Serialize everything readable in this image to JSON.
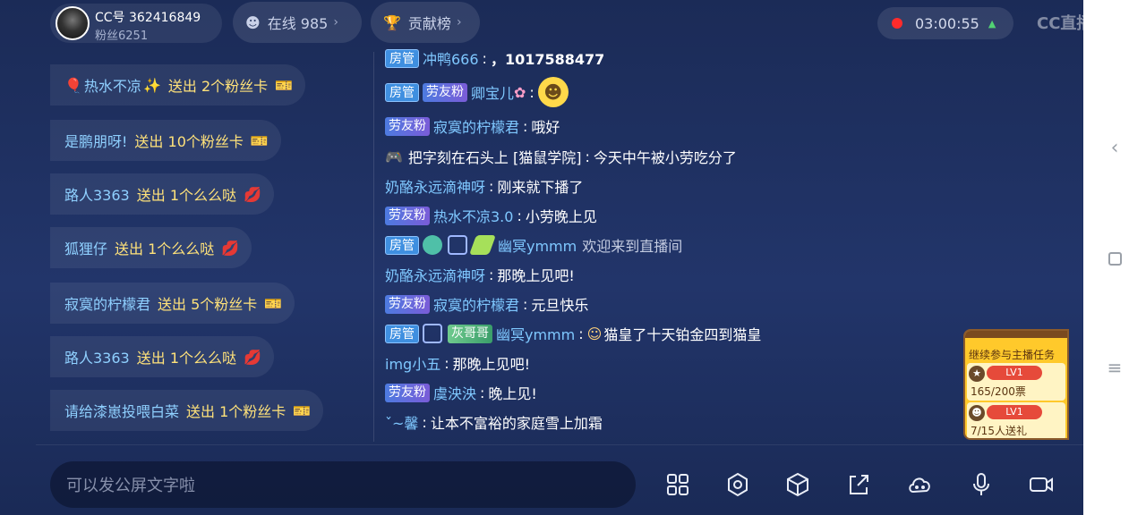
{
  "header": {
    "cc_id": "CC号 362416849",
    "fans": "粉丝6251",
    "online": "在线 985",
    "rank": "贡献榜",
    "timer": "03:00:55",
    "logo": "CC直播"
  },
  "gifts": [
    {
      "user": "热水不凉",
      "action": "送出 2个粉丝卡",
      "icon": "card"
    },
    {
      "user": "是鹏朋呀!",
      "action": "送出 10个粉丝卡",
      "icon": "card"
    },
    {
      "user": "路人3363",
      "action": "送出 1个么么哒",
      "icon": "kiss"
    },
    {
      "user": "狐狸仔",
      "action": "送出 1个么么哒",
      "icon": "kiss"
    },
    {
      "user": "寂寞的柠檬君",
      "action": "送出 5个粉丝卡",
      "icon": "card"
    },
    {
      "user": "路人3363",
      "action": "送出 1个么么哒",
      "icon": "kiss"
    },
    {
      "user": "请给漆崽投喂白菜",
      "action": "送出 1个粉丝卡",
      "icon": "card"
    }
  ],
  "badges": {
    "manager": "房管",
    "fan": "劳友粉",
    "grey": "灰哥哥"
  },
  "chat": [
    {
      "user": "冲鸭666",
      "text": "，1017588477"
    },
    {
      "user": "卿宝儿",
      "text": ""
    },
    {
      "user": "寂寞的柠檬君",
      "text": "哦好"
    },
    {
      "user": "把字刻在石头上 [猫鼠学院]",
      "text": "今天中午被小劳吃分了"
    },
    {
      "user": "奶酪永远滴神呀",
      "text": "刚来就下播了"
    },
    {
      "user": "热水不凉3.0",
      "text": "小劳晚上见"
    },
    {
      "user": "幽冥ymmm",
      "text": "欢迎来到直播间"
    },
    {
      "user": "奶酪永远滴神呀",
      "text": "那晚上见吧!"
    },
    {
      "user": "寂寞的柠檬君",
      "text": "元旦快乐"
    },
    {
      "user": "幽冥ymmm",
      "text": "猫皇了十天铂金四到猫皇"
    },
    {
      "user": "img小五",
      "text": "那晚上见吧!"
    },
    {
      "user": "虞泱泱",
      "text": "晚上见!"
    },
    {
      "user": "ˇ~馨",
      "text": "让本不富裕的家庭雪上加霜"
    }
  ],
  "task": {
    "title": "继续参与主播任务",
    "level1": "LV1",
    "progress1": "165/200票",
    "level2": "LV1",
    "progress2": "7/15人送礼"
  },
  "input": {
    "placeholder": "可以发公屏文字啦"
  }
}
